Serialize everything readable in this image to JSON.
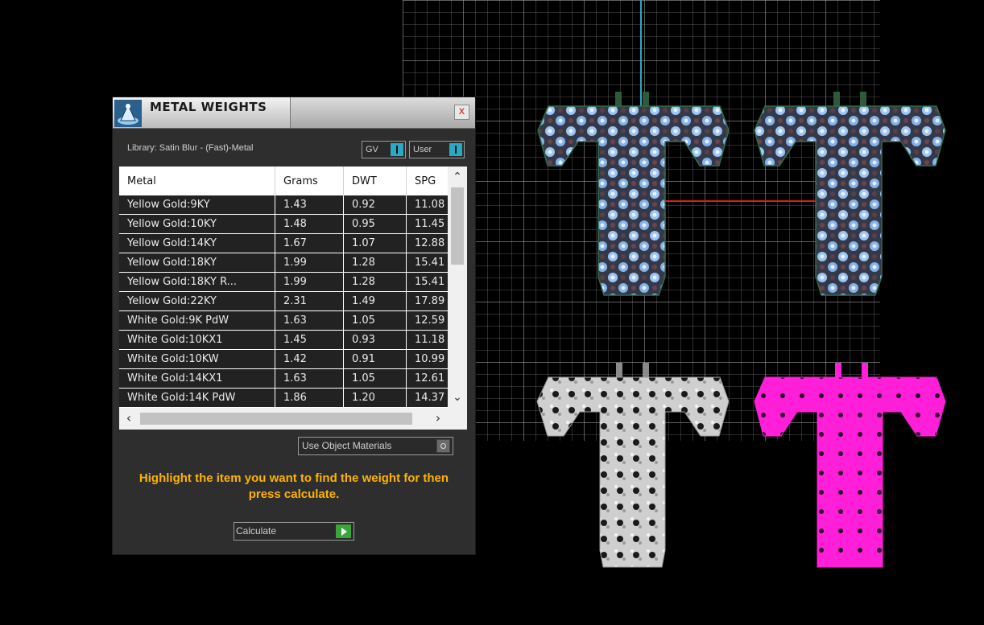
{
  "dialog": {
    "title": "METAL WEIGHTS",
    "close_label": "x",
    "library_label": "Library: Satin Blur - (Fast)-Metal",
    "toggles": {
      "gv_label": "GV",
      "user_label": "User"
    },
    "table": {
      "headers": [
        "Metal",
        "Grams",
        "DWT",
        "SPG"
      ],
      "rows": [
        [
          "Yellow Gold:9KY",
          "1.43",
          "0.92",
          "11.08"
        ],
        [
          "Yellow Gold:10KY",
          "1.48",
          "0.95",
          "11.45"
        ],
        [
          "Yellow Gold:14KY",
          "1.67",
          "1.07",
          "12.88"
        ],
        [
          "Yellow Gold:18KY",
          "1.99",
          "1.28",
          "15.41"
        ],
        [
          "Yellow Gold:18KY R...",
          "1.99",
          "1.28",
          "15.41"
        ],
        [
          "Yellow Gold:22KY",
          "2.31",
          "1.49",
          "17.89"
        ],
        [
          "White Gold:9K PdW",
          "1.63",
          "1.05",
          "12.59"
        ],
        [
          "White Gold:10KX1",
          "1.45",
          "0.93",
          "11.18"
        ],
        [
          "White Gold:10KW",
          "1.42",
          "0.91",
          "10.99"
        ],
        [
          "White Gold:14KX1",
          "1.63",
          "1.05",
          "12.61"
        ],
        [
          "White Gold:14K PdW",
          "1.86",
          "1.20",
          "14.37"
        ]
      ]
    },
    "use_object_materials_label": "Use Object Materials",
    "instructions": "Highlight the item you want to find the weight for then press calculate.",
    "calculate_label": "Calculate"
  },
  "colors": {
    "background": "#000000",
    "grid": "#6f6f6f",
    "accent_blue": "#29a9c4",
    "instruction_text": "#ffb300",
    "pink_letter": "#ff1fd8",
    "blue_letter": "#8ab6ee",
    "white_letter": "#d0d0d0",
    "calculate_button": "#3aa53a"
  },
  "viewport": {
    "objects": [
      "blue-gem-letter-T",
      "blue-gem-letter-T",
      "white-perforated-letter-T",
      "pink-perforated-letter-T"
    ]
  }
}
